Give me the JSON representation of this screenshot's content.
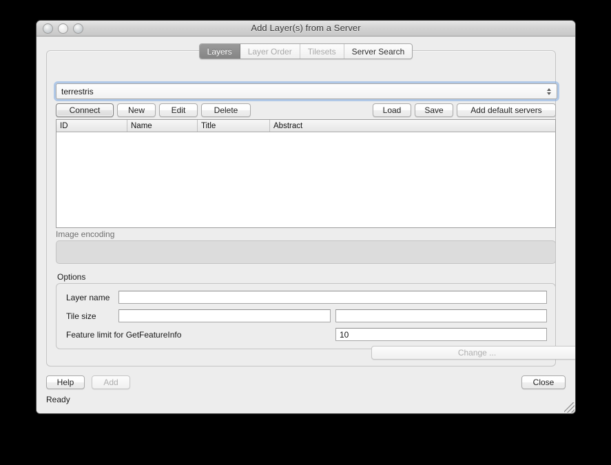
{
  "window": {
    "title": "Add Layer(s) from a Server",
    "controls": {
      "close": "close-button",
      "minimize": "minimize-button",
      "zoom": "zoom-button"
    }
  },
  "tabs": [
    {
      "label": "Layers",
      "state": "selected"
    },
    {
      "label": "Layer Order",
      "state": "disabled"
    },
    {
      "label": "Tilesets",
      "state": "disabled"
    },
    {
      "label": "Server Search",
      "state": "enabled"
    }
  ],
  "connection": {
    "selected_server": "terrestris",
    "buttons_left": [
      {
        "label": "Connect",
        "state": "default"
      },
      {
        "label": "New",
        "state": "enabled"
      },
      {
        "label": "Edit",
        "state": "enabled"
      },
      {
        "label": "Delete",
        "state": "enabled"
      }
    ],
    "buttons_right": [
      {
        "label": "Load",
        "state": "enabled"
      },
      {
        "label": "Save",
        "state": "enabled"
      },
      {
        "label": "Add default servers",
        "state": "enabled"
      }
    ]
  },
  "layer_table": {
    "columns": [
      "ID",
      "Name",
      "Title",
      "Abstract"
    ],
    "rows": []
  },
  "image_encoding": {
    "label": "Image encoding",
    "options": [],
    "state": "disabled"
  },
  "options": {
    "title": "Options",
    "layer_name": {
      "label": "Layer name",
      "value": ""
    },
    "tile_size": {
      "label": "Tile size",
      "width_value": "",
      "height_value": ""
    },
    "feature_limit": {
      "label": "Feature limit for GetFeatureInfo",
      "value": "10"
    },
    "change_button": {
      "label": "Change ...",
      "state": "disabled"
    }
  },
  "footer": {
    "help": {
      "label": "Help",
      "state": "enabled"
    },
    "add": {
      "label": "Add",
      "state": "disabled"
    },
    "close": {
      "label": "Close",
      "state": "enabled"
    },
    "status": "Ready"
  },
  "colors": {
    "window_bg": "#ededed",
    "selected_tab_bg": "#8f8f8f",
    "focus_ring": "#7daae1",
    "field_bg": "#ffffff",
    "disabled_text": "#aeaeae"
  }
}
